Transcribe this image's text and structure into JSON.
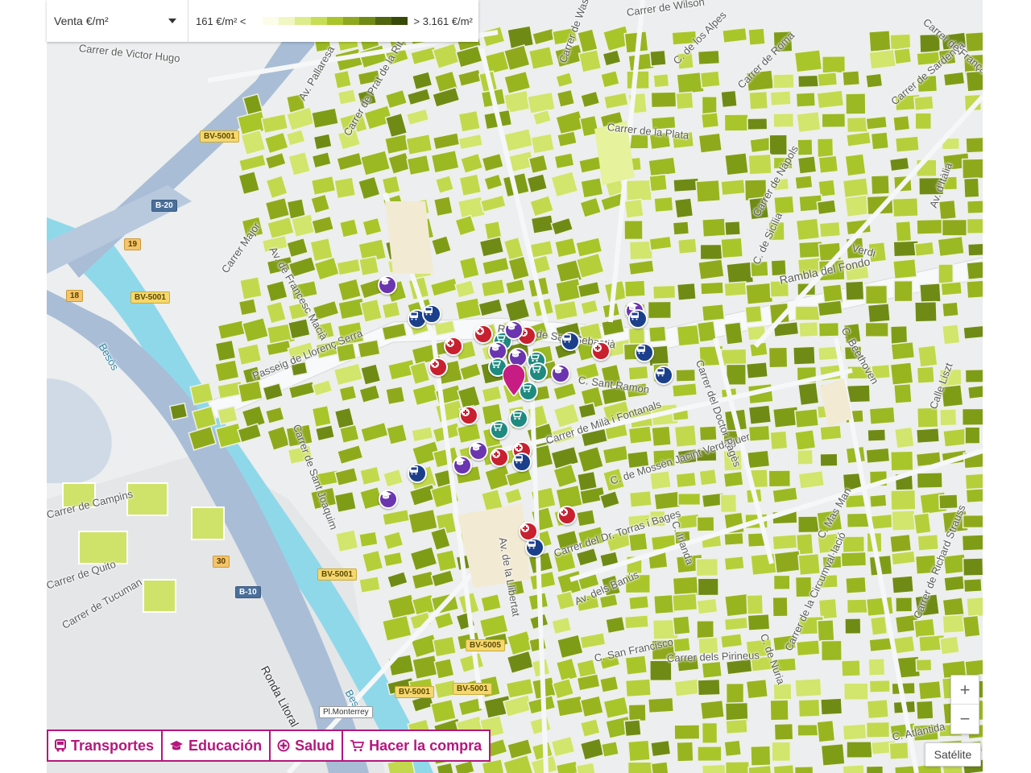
{
  "legend": {
    "mode_label": "Venta €/m²",
    "min_label": "161 €/m² <",
    "max_label": "> 3.161 €/m²",
    "colors": [
      "#fbfde8",
      "#f0f7c2",
      "#dcec8a",
      "#c7dd55",
      "#aac42c",
      "#8ea820",
      "#6f8b16",
      "#4f660e",
      "#384a08"
    ]
  },
  "categories": [
    {
      "label": "Transportes",
      "icon": "bus-icon"
    },
    {
      "label": "Educación",
      "icon": "graduation-cap-icon"
    },
    {
      "label": "Salud",
      "icon": "cross-icon"
    },
    {
      "label": "Hacer la compra",
      "icon": "shopping-cart-icon"
    }
  ],
  "controls": {
    "zoom_in": "+",
    "zoom_out": "−",
    "satellite": "Satélite"
  },
  "colors": {
    "accent": "#b5177d",
    "transport": "#1b3f8b",
    "education": "#6b35b0",
    "health": "#c8202f",
    "shopping": "#1f8a80",
    "highway": "#8fa9c9",
    "river": "#8fd8ea"
  },
  "map_labels": {
    "victor_hugo": "Carrer de Victor Hugo",
    "pallaresa": "Av. Pallaresa",
    "prat_riba": "Carrer de Prat de la Riba",
    "major": "Carrer Major",
    "macia": "Av. de Francesc Macià",
    "llorenc_serra": "Passeig de Llorenç Serra",
    "sant_sebastia": "Rambla de Sant Sebastià",
    "fondo": "Rambla del Fondo",
    "planeta": "Carrer de la Plata",
    "napols": "Carrer de Nàpols",
    "roma": "Carrer de Roma",
    "sicilia": "C. de Sicília",
    "sardenya": "Carrer de Sardenya",
    "italia": "Av. d'Itàlia",
    "besos": "Besòs",
    "besos2": "Besòs",
    "ronda_litoral": "Ronda Litoral",
    "tucuman": "Carrer de Tucuman",
    "quito": "Carrer de Quito",
    "campins": "Carrer de Campins",
    "milla_fontanals": "Carrer de Milà i Fontanals",
    "mossen_jacint": "C. de Mossèn Jacint Verdaguer",
    "torras_bages": "Carrer del Dr. Torras i Bages",
    "banus": "Av. dels Banús",
    "san_francisco": "C. San Francisco",
    "pirineus": "Carrer dels Pirineus",
    "irlanda": "C. Irlanda",
    "circumval": "Carrer de la Circumval·lació",
    "atlantida": "C. Atlàntida",
    "llibertat": "Av. de la Llibertat",
    "mas_man": "C. Mas Man",
    "sant_joaquim": "Carrer de Sant Joaquim",
    "beethoven": "C. Beethoven",
    "dr_pages": "Carrer del Doctor Pagès",
    "liszt": "Calle Liszt",
    "sant_ramon": "C. Sant Ramon",
    "wilson": "Carrer de Wilson",
    "france": "Carrer de França",
    "los_alpes": "C. de los Alpes",
    "verdi": "Verdi",
    "nuria": "C. de Núria",
    "richard_strauss": "Carrer de Richard Strauss",
    "washington": "Carrer de Washington"
  },
  "shields": {
    "bv5001_a": "BV-5001",
    "b20": "B-20",
    "n19": "19",
    "n18": "18",
    "bv5001_b": "BV-5001",
    "bv5001_c": "BV-5001",
    "n30": "30",
    "b10": "B-10",
    "bv5005": "BV-5005",
    "bv5001_d": "BV-5001",
    "bv5001_e": "BV-5001",
    "monterrey": "Pl.Monterrey"
  }
}
